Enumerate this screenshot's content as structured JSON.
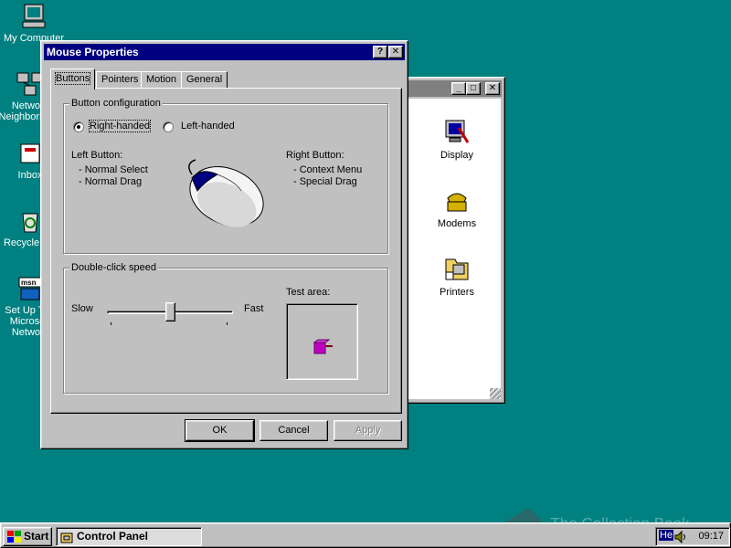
{
  "desktop": {
    "icons": [
      {
        "label": "My Computer",
        "icon": "my-computer-icon"
      },
      {
        "label": "Network\nNeighborhood",
        "icon": "network-neighborhood-icon"
      },
      {
        "label": "Inbox",
        "icon": "inbox-icon"
      },
      {
        "label": "Recycle Bin",
        "icon": "recycle-bin-icon"
      },
      {
        "label": "Set Up The\nMicrosoft\nNetwork",
        "icon": "msn-setup-icon"
      }
    ]
  },
  "control_panel": {
    "items": [
      {
        "label": "Display",
        "icon": "display-icon"
      },
      {
        "label": "Modems",
        "icon": "modems-icon"
      },
      {
        "label": "Printers",
        "icon": "printers-icon"
      }
    ]
  },
  "dialog": {
    "title": "Mouse Properties",
    "tabs": [
      "Buttons",
      "Pointers",
      "Motion",
      "General"
    ],
    "active_tab": "Buttons",
    "button_config": {
      "title": "Button configuration",
      "right_handed": "Right-handed",
      "left_handed": "Left-handed",
      "selected": "Right-handed",
      "left_button_title": "Left Button:",
      "left_button_items": [
        "-  Normal Select",
        "-  Normal Drag"
      ],
      "right_button_title": "Right Button:",
      "right_button_items": [
        "-  Context Menu",
        "-  Special Drag"
      ]
    },
    "double_click": {
      "title": "Double-click speed",
      "slow": "Slow",
      "fast": "Fast",
      "speed_fraction": 0.5,
      "test_area": "Test area:"
    },
    "buttons": {
      "ok": "OK",
      "cancel": "Cancel",
      "apply": "Apply"
    }
  },
  "taskbar": {
    "start": "Start",
    "task": "Control Panel",
    "tray_label": "He",
    "clock": "09:17"
  },
  "watermark": "The Collection Book",
  "colors": {
    "desktop": "#008080",
    "title_active": "#000080",
    "title_inactive": "#808080"
  }
}
